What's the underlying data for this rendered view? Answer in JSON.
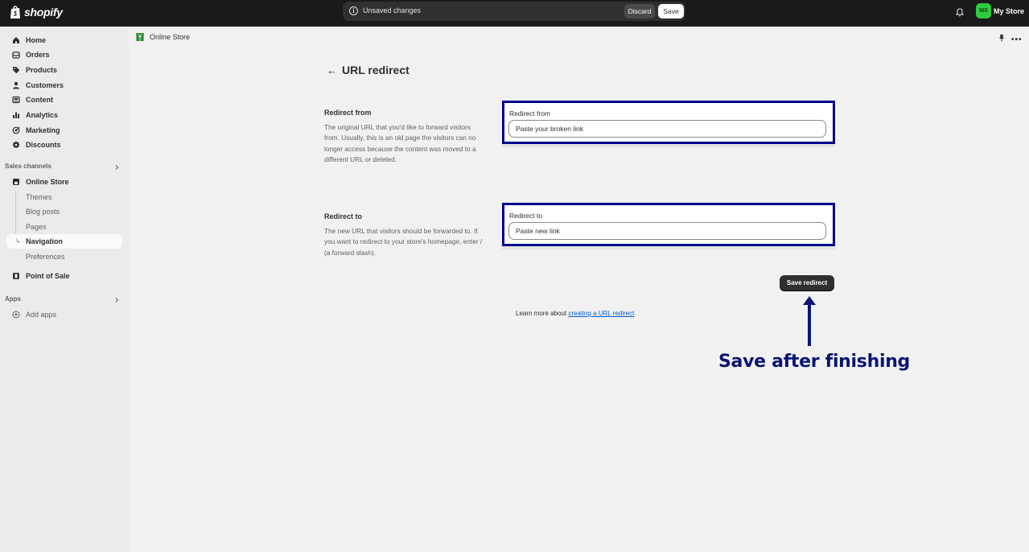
{
  "app": {
    "logo_text": "shopify"
  },
  "topbar": {
    "unsaved_text": "Unsaved changes",
    "discard_label": "Discard",
    "save_label": "Save",
    "avatar_initials": "MS",
    "store_name": "My Store",
    "avatar_color": "#2ecc40"
  },
  "sidebar": {
    "items": [
      {
        "label": "Home",
        "icon": "home-icon"
      },
      {
        "label": "Orders",
        "icon": "orders-icon"
      },
      {
        "label": "Products",
        "icon": "tag-icon"
      },
      {
        "label": "Customers",
        "icon": "person-icon"
      },
      {
        "label": "Content",
        "icon": "content-icon"
      },
      {
        "label": "Analytics",
        "icon": "bar-chart-icon"
      },
      {
        "label": "Marketing",
        "icon": "target-icon"
      },
      {
        "label": "Discounts",
        "icon": "discount-icon"
      }
    ],
    "sales_channels_label": "Sales channels",
    "online_store_label": "Online Store",
    "sub_items": [
      "Themes",
      "Blog posts",
      "Pages",
      "Navigation",
      "Preferences"
    ],
    "active_sub_item": "Navigation",
    "point_of_sale_label": "Point of Sale",
    "apps_label": "Apps",
    "add_apps_label": "Add apps"
  },
  "main": {
    "breadcrumb": "Online Store",
    "page_title": "URL redirect",
    "redirect_from": {
      "section_title": "Redirect from",
      "description": "The original URL that you'd like to forward visitors from. Usually, this is an old page the visitors can no longer access because the content was moved to a different URL or deleted.",
      "field_label": "Redirect from",
      "placeholder": "Paste your broken link"
    },
    "redirect_to": {
      "section_title": "Redirect to",
      "description": "The new URL that visitors should be forwarded to. If you want to redirect to your store's homepage, enter / (a forward slash).",
      "field_label": "Redirect to",
      "placeholder": "Paste new link"
    },
    "save_redirect_label": "Save redirect",
    "learn_more_prefix": "Learn more about",
    "learn_more_link": "creating a URL redirect"
  },
  "annotation": {
    "text": "Save after finishing",
    "color": "#0a1672",
    "highlight_color": "#00008b"
  }
}
